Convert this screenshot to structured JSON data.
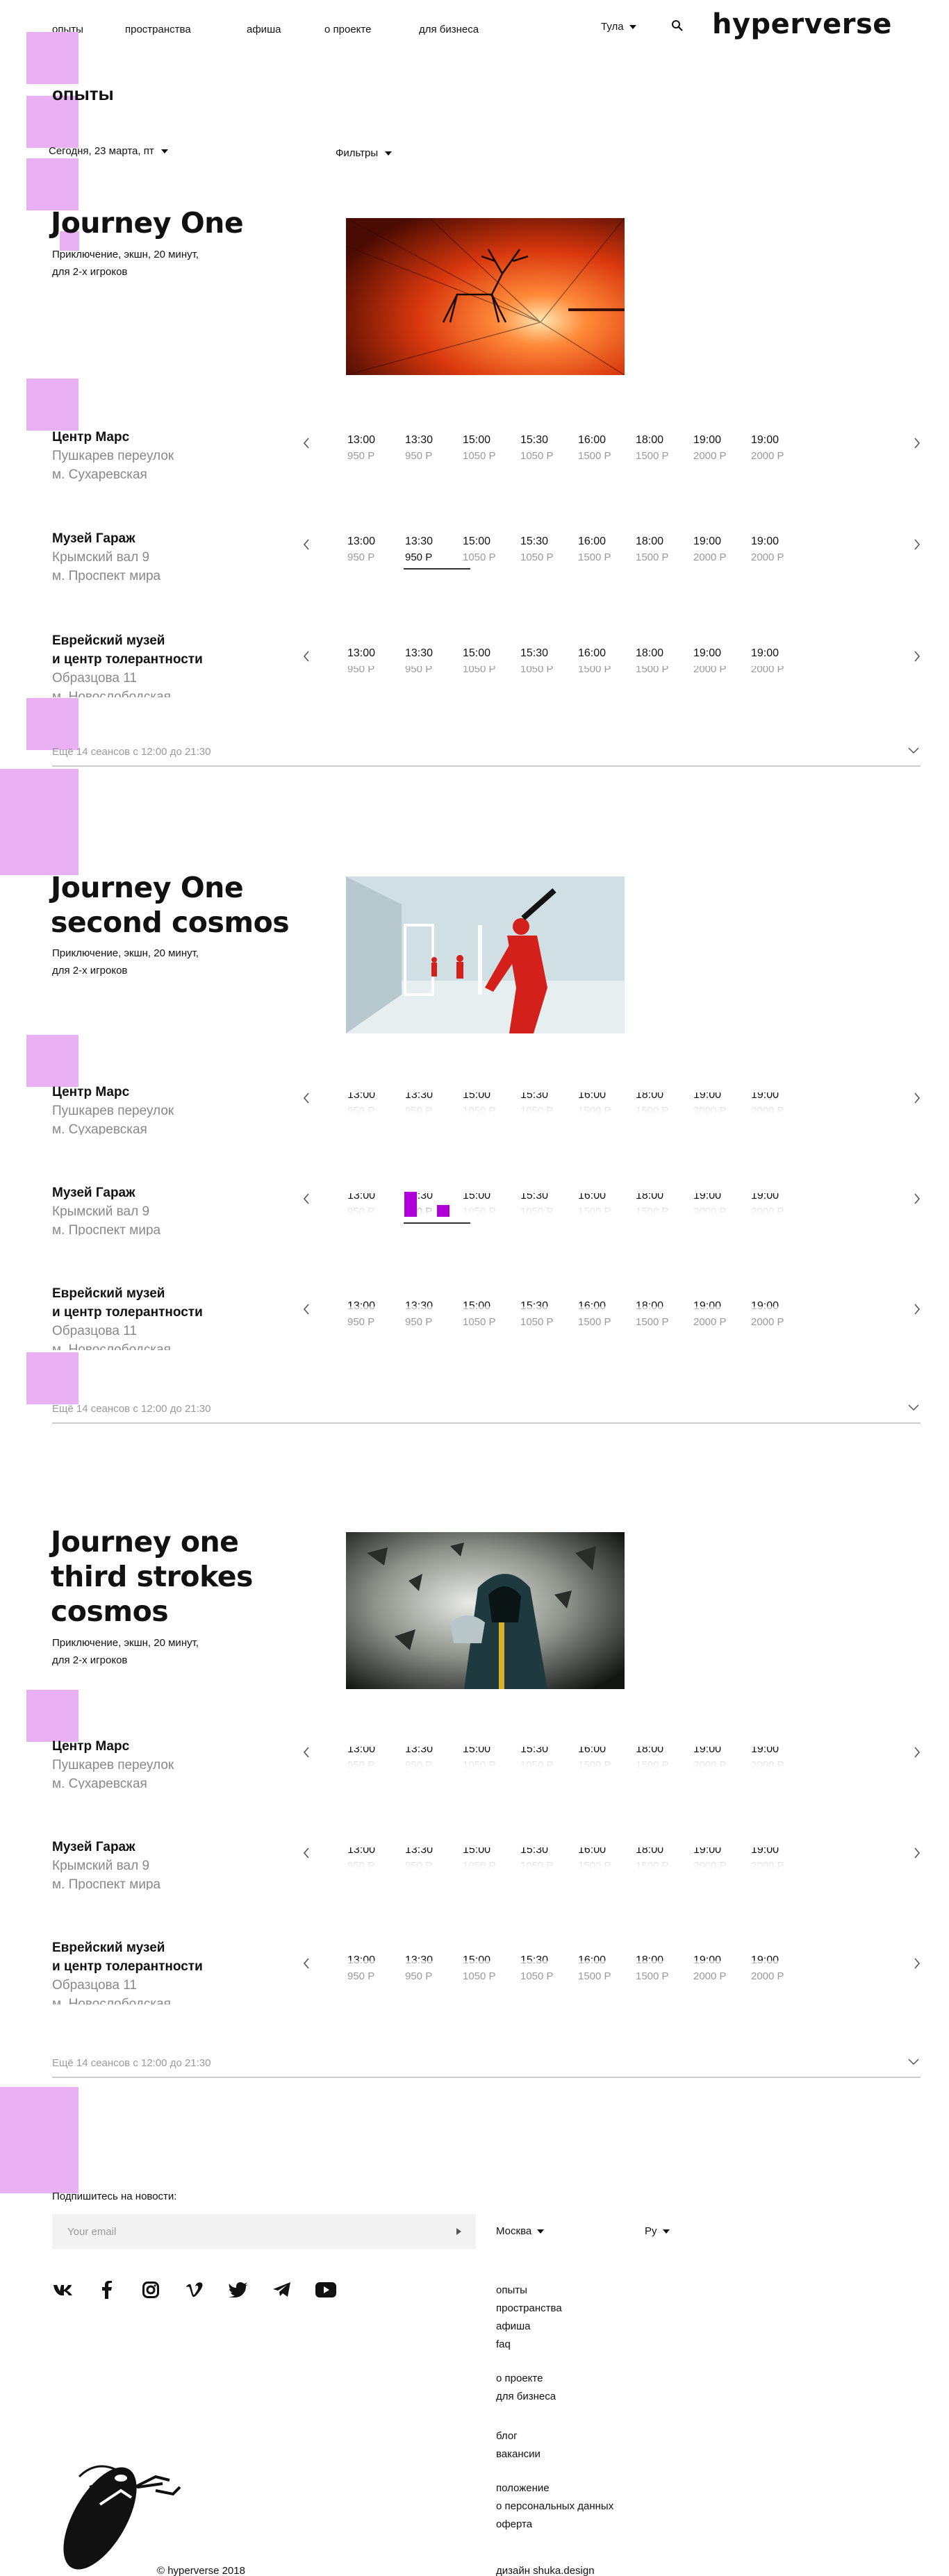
{
  "header": {
    "nav": [
      "опыты",
      "пространства",
      "афиша",
      "о проекте",
      "для бизнеса"
    ],
    "city": "Тула",
    "logo": "hyperverse"
  },
  "page_title": "опыты",
  "date_filter": "Сегодня, 23 марта, пт",
  "filters_label": "Фильтры",
  "slots": [
    {
      "time": "13:00",
      "price": "950 Р"
    },
    {
      "time": "13:30",
      "price": "950 Р"
    },
    {
      "time": "15:00",
      "price": "1050 Р"
    },
    {
      "time": "15:30",
      "price": "1050 Р"
    },
    {
      "time": "16:00",
      "price": "1500 Р"
    },
    {
      "time": "18:00",
      "price": "1500 Р"
    },
    {
      "time": "19:00",
      "price": "2000 Р"
    },
    {
      "time": "19:00",
      "price": "2000 Р"
    }
  ],
  "experiences": [
    {
      "title_lines": [
        "Journey One"
      ],
      "desc_lines": [
        "Приключение, экшн, 20 минут,",
        "для 2-х игроков"
      ],
      "image": "red-corridor-deer",
      "venues": [
        {
          "name_lines": [
            "Центр Марс"
          ],
          "addr_lines": [
            "Пушкарев переулок",
            "м. Сухаревская"
          ],
          "selected": -1
        },
        {
          "name_lines": [
            "Музей Гараж"
          ],
          "addr_lines": [
            "Крымский вал 9",
            "м. Проспект мира"
          ],
          "selected": 1
        },
        {
          "name_lines": [
            "Еврейский музей",
            "и центр толерантности"
          ],
          "addr_lines": [
            "Образцова 11",
            "м. Новослободская"
          ],
          "selected": -1
        }
      ],
      "more": "Ещё 14 сеансов с 12:00 до 21:30"
    },
    {
      "title_lines": [
        "Journey One",
        "second cosmos"
      ],
      "desc_lines": [
        "Приключение, экшн, 20 минут,",
        "для 2-х игроков"
      ],
      "image": "red-figures-white-room",
      "venues": [
        {
          "name_lines": [
            "Центр Марс"
          ],
          "addr_lines": [
            "Пушкарев переулок",
            "м. Сухаревская"
          ],
          "selected": -1
        },
        {
          "name_lines": [
            "Музей Гараж"
          ],
          "addr_lines": [
            "Крымский вал 9",
            "м. Проспект мира"
          ],
          "selected": 1
        },
        {
          "name_lines": [
            "Еврейский музей",
            "и центр толерантности"
          ],
          "addr_lines": [
            "Образцова 11",
            "м. Новослободская"
          ],
          "selected": -1
        }
      ],
      "more": "Ещё 14 сеансов с 12:00 до 21:30"
    },
    {
      "title_lines": [
        "Journey one",
        "third strokes",
        "cosmos"
      ],
      "desc_lines": [
        "Приключение, экшн, 20 минут,",
        "для 2-х игроков"
      ],
      "image": "hooded-figure-debris",
      "venues": [
        {
          "name_lines": [
            "Центр Марс"
          ],
          "addr_lines": [
            "Пушкарев переулок",
            "м. Сухаревская"
          ],
          "selected": -1
        },
        {
          "name_lines": [
            "Музей Гараж"
          ],
          "addr_lines": [
            "Крымский вал 9",
            "м. Проспект мира"
          ],
          "selected": -1
        },
        {
          "name_lines": [
            "Еврейский музей",
            "и центр толерантности"
          ],
          "addr_lines": [
            "Образцова 11",
            "м. Новослободская"
          ],
          "selected": -1
        }
      ],
      "more": "Ещё 14 сеансов с 12:00 до 21:30"
    }
  ],
  "footer": {
    "subscribe_label": "Подпишитесь на новости:",
    "email_placeholder": "Your email",
    "city": "Москва",
    "lang": "Ру",
    "socials": [
      "vk-icon",
      "facebook-icon",
      "instagram-icon",
      "vimeo-icon",
      "twitter-icon",
      "telegram-icon",
      "youtube-icon"
    ],
    "links_group1": [
      "опыты",
      "пространства",
      "афиша",
      "faq"
    ],
    "links_group2": [
      "о проекте",
      "для бизнеса"
    ],
    "links_group3": [
      "блог",
      "вакансии"
    ],
    "links_group4": [
      "положение",
      "о персональных данных",
      "оферта"
    ],
    "copyright": "© hyperverse 2018",
    "credits": "дизайн shuka.design"
  },
  "colors": {
    "accent_pink": "#eab0f4",
    "accent_purple": "#b000d8",
    "muted": "#999999"
  }
}
